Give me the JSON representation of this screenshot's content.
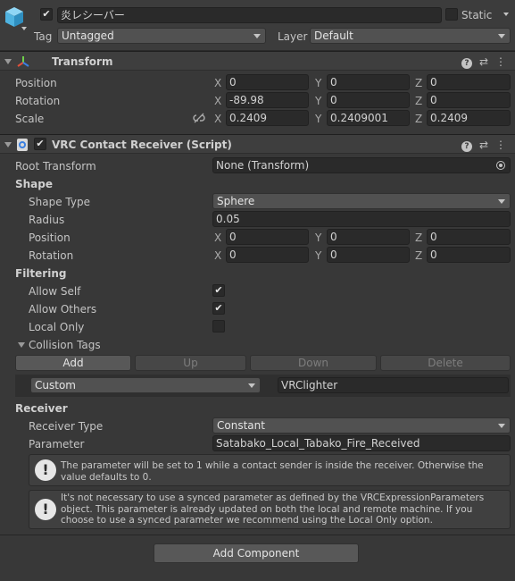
{
  "header": {
    "name": "炎レシーバー",
    "static_label": "Static",
    "tag_label": "Tag",
    "tag_value": "Untagged",
    "layer_label": "Layer",
    "layer_value": "Default"
  },
  "transform": {
    "title": "Transform",
    "position_label": "Position",
    "rotation_label": "Rotation",
    "scale_label": "Scale",
    "axis": {
      "x": "X",
      "y": "Y",
      "z": "Z"
    },
    "position": {
      "x": "0",
      "y": "0",
      "z": "0"
    },
    "rotation": {
      "x": "-89.98",
      "y": "0",
      "z": "0"
    },
    "scale": {
      "x": "0.2409",
      "y": "0.2409001",
      "z": "0.2409"
    }
  },
  "receiver_comp": {
    "title": "VRC Contact Receiver (Script)",
    "root_transform_label": "Root Transform",
    "root_transform_value": "None (Transform)",
    "shape_section": "Shape",
    "shape_type_label": "Shape Type",
    "shape_type_value": "Sphere",
    "radius_label": "Radius",
    "radius_value": "0.05",
    "position_label": "Position",
    "position": {
      "x": "0",
      "y": "0",
      "z": "0"
    },
    "rotation_label": "Rotation",
    "rotation": {
      "x": "0",
      "y": "0",
      "z": "0"
    },
    "filtering_section": "Filtering",
    "allow_self_label": "Allow Self",
    "allow_others_label": "Allow Others",
    "local_only_label": "Local Only",
    "collision_tags_label": "Collision Tags",
    "btn_add": "Add",
    "btn_up": "Up",
    "btn_down": "Down",
    "btn_delete": "Delete",
    "tag_type": "Custom",
    "tag_value": "VRClighter",
    "receiver_section": "Receiver",
    "receiver_type_label": "Receiver Type",
    "receiver_type_value": "Constant",
    "parameter_label": "Parameter",
    "parameter_value": "Satabako_Local_Tabako_Fire_Received",
    "help1": "The parameter will be set to 1 while a contact sender is inside the receiver.  Otherwise the value defaults to 0.",
    "help2": "It's not necessary to use a synced parameter as defined by the VRCExpressionParameters object.  This parameter is already updated on both the local and remote machine.  If you choose to use a synced parameter we recommend using the Local Only option."
  },
  "add_component": "Add Component",
  "checks": {
    "active": true,
    "static": false,
    "comp_enabled": true,
    "allow_self": true,
    "allow_others": true,
    "local_only": false
  }
}
